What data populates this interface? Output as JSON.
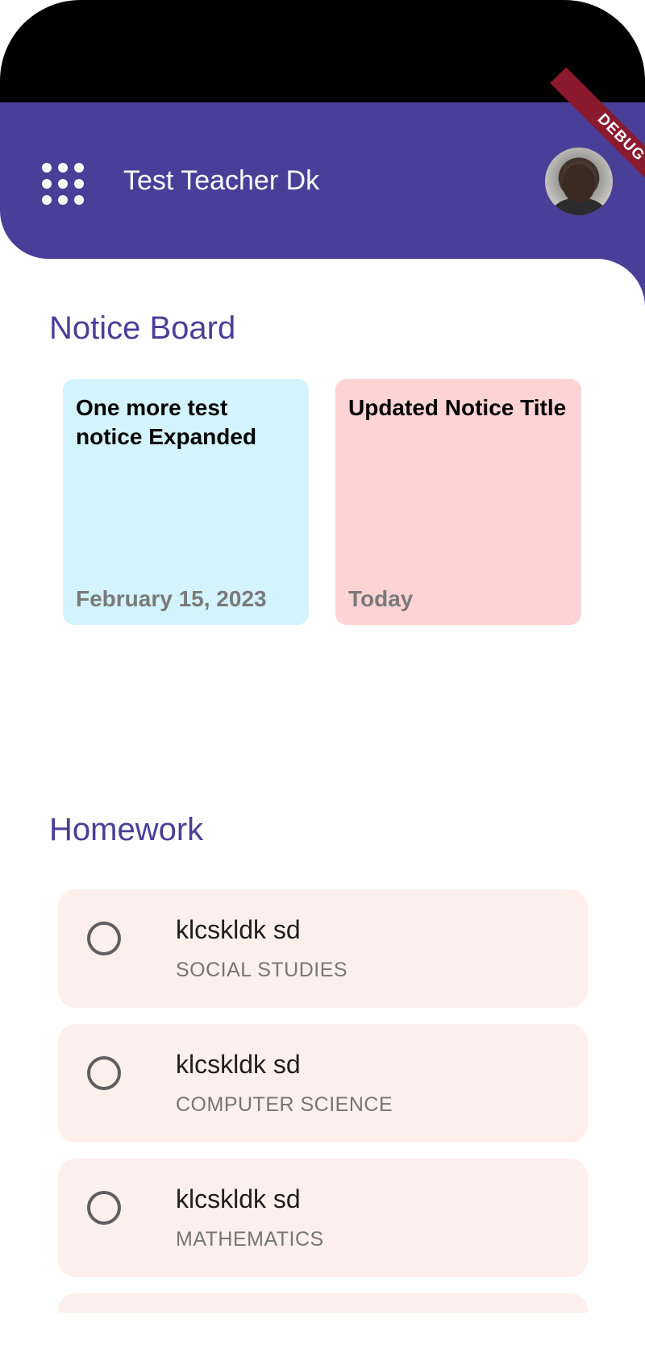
{
  "app_bar": {
    "title": "Test Teacher Dk",
    "menu_icon": "grid-dots-icon",
    "debug_label": "DEBUG",
    "background_color": "#4a3f98"
  },
  "notice_board": {
    "heading": "Notice Board",
    "notices": [
      {
        "title": "One more test notice Expanded",
        "date": "February 15, 2023",
        "color": "#d3f3fd"
      },
      {
        "title": "Updated Notice Title",
        "date": "Today",
        "color": "#fdd3d4"
      }
    ]
  },
  "homework": {
    "heading": "Homework",
    "items": [
      {
        "title": "klcskldk sd",
        "subject": "SOCIAL STUDIES"
      },
      {
        "title": "klcskldk sd",
        "subject": "COMPUTER SCIENCE"
      },
      {
        "title": "klcskldk sd",
        "subject": "MATHEMATICS"
      }
    ]
  }
}
